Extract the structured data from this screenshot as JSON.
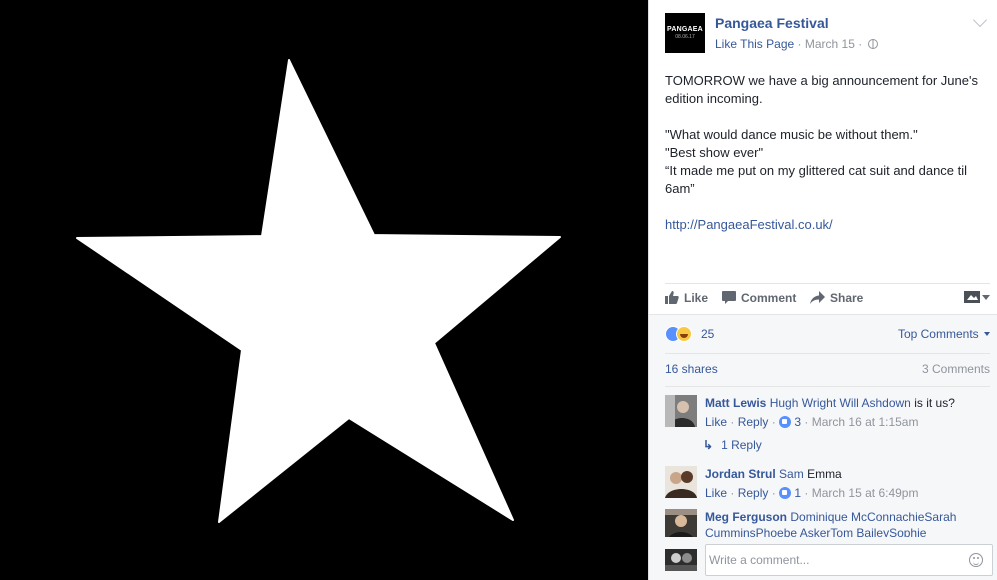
{
  "photo": {
    "background": "#000000",
    "star_color": "#ffffff"
  },
  "page": {
    "avatar_text": "PANGAEA",
    "avatar_subtext": "08.06.17",
    "name": "Pangaea Festival",
    "like_page": "Like This Page",
    "date": "March 15",
    "privacy_icon": "globe-icon"
  },
  "post": {
    "lines": [
      "TOMORROW we have a big announcement for June's edition incoming.",
      "",
      "\"What would dance music be without them.\"",
      "\"Best show ever\"",
      "“It made me put on my glittered cat suit and dance til 6am”",
      "",
      "http://PangaeaFestival.co.uk/"
    ]
  },
  "actions": {
    "like": "Like",
    "comment": "Comment",
    "share": "Share"
  },
  "stats": {
    "reaction_count": "25",
    "reaction_icons": [
      "like-icon",
      "haha-icon"
    ],
    "sort": "Top Comments",
    "shares": "16 shares",
    "comments": "3 Comments"
  },
  "comments": [
    {
      "author": "Matt Lewis",
      "tags": "Hugh Wright Will Ashdown",
      "text": "is it us?",
      "like": "Like",
      "reply": "Reply",
      "likes": "3",
      "time": "March 16 at 1:15am",
      "replies": "1 Reply"
    },
    {
      "author": "Jordan Strul",
      "tags": "Sam",
      "text": "Emma",
      "like": "Like",
      "reply": "Reply",
      "likes": "1",
      "time": "March 15 at 6:49pm"
    },
    {
      "author": "Meg Ferguson",
      "tags": "Dominique McConnachieSarah CumminsPhoebe AskerTom BaileySophie",
      "text": ""
    }
  ],
  "composer": {
    "placeholder": "Write a comment..."
  },
  "colors": {
    "link": "#365899",
    "muted": "#90949c",
    "text": "#1d2129"
  }
}
